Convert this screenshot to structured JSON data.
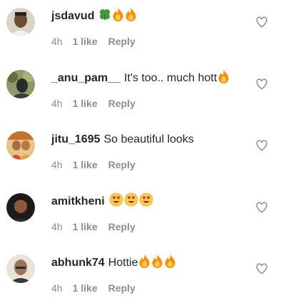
{
  "comments": [
    {
      "username": "jsdavud",
      "text": "",
      "emojis": [
        "shamrock-emoji",
        "fire-emoji",
        "fire-emoji"
      ],
      "time": "4h",
      "likes": "1 like",
      "reply": "Reply",
      "avatar_color": "#6b4c32"
    },
    {
      "username": "_anu_pam__",
      "text": "It's too.. much hott",
      "emojis": [
        "fire-emoji"
      ],
      "time": "4h",
      "likes": "1 like",
      "reply": "Reply",
      "avatar_color": "#4e5a3a"
    },
    {
      "username": "jitu_1695",
      "text": "So beautiful looks",
      "emojis": [],
      "time": "4h",
      "likes": "1 like",
      "reply": "Reply",
      "avatar_color": "#c9a25f"
    },
    {
      "username": "amitkheni",
      "text": "",
      "emojis": [
        "heart-eyes-emoji",
        "heart-eyes-emoji",
        "heart-eyes-emoji"
      ],
      "time": "4h",
      "likes": "1 like",
      "reply": "Reply",
      "avatar_color": "#3a2e28"
    },
    {
      "username": "abhunk74",
      "text": "Hottie",
      "emojis": [
        "fire-emoji",
        "fire-emoji",
        "fire-emoji"
      ],
      "time": "4h",
      "likes": "1 like",
      "reply": "Reply",
      "avatar_color": "#8a6e55"
    }
  ],
  "colors": {
    "text": "#262626",
    "meta": "#8e8e8e",
    "heart_stroke": "#8e8e8e",
    "fire_outer": "#f4900c",
    "fire_inner": "#ffcc4d",
    "shamrock": "#3e9b3e",
    "heart_eyes_face": "#ffcc4d",
    "heart_eyes_heart": "#e0245e"
  }
}
